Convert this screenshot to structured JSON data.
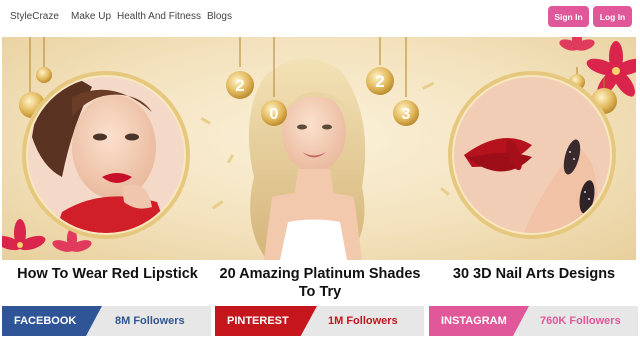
{
  "header": {
    "logo": "StyleCraze",
    "nav": [
      "Make Up",
      "Health And Fitness",
      "Blogs"
    ],
    "signin_label": "Sign In",
    "login_label": "Log In"
  },
  "hero": {
    "year_digits": [
      "2",
      "0",
      "2",
      "3"
    ]
  },
  "articles": [
    {
      "title": "How To Wear Red Lipstick"
    },
    {
      "title": "20 Amazing Platinum Shades To Try"
    },
    {
      "title": "30 3D Nail Arts Designs"
    }
  ],
  "social": [
    {
      "network": "FACEBOOK",
      "followers": "8M Followers",
      "color": "#2f5597"
    },
    {
      "network": "PINTEREST",
      "followers": "1M Followers",
      "color": "#c4161c"
    },
    {
      "network": "INSTAGRAM",
      "followers": "760K Followers",
      "color": "#e0589a"
    }
  ],
  "colors": {
    "accent": "#e0589a",
    "hero_bg": "#f3e2bd"
  }
}
